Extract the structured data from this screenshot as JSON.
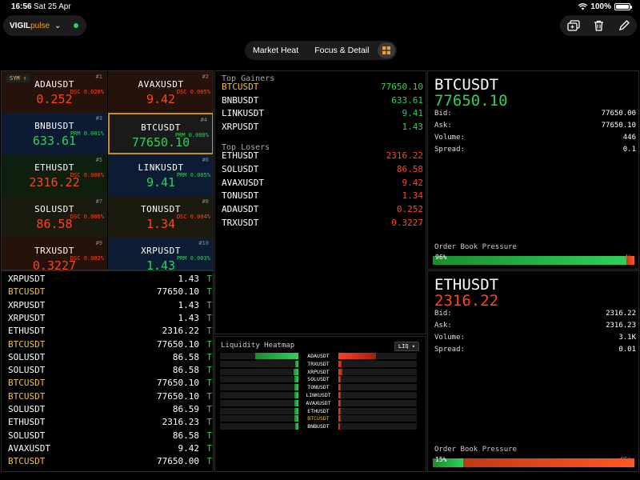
{
  "status_bar": {
    "time": "16:56",
    "date": "Sat 25 Apr",
    "battery": "100%"
  },
  "app": {
    "name_bold": "VIGIL",
    "name_light": "pulse",
    "connection_color": "#30d158"
  },
  "view_switcher": {
    "tabs": [
      "Market Heat",
      "Focus & Detail"
    ],
    "active_icon": "grid-icon"
  },
  "colors": {
    "up": "#30d158",
    "down": "#ff4520",
    "selected": "#f0c040"
  },
  "heat_grid": {
    "sort_label": "SYM ↑",
    "tiles": [
      {
        "symbol": "ADAUSDT",
        "price": "0.252",
        "rank": "#1",
        "tag": "DSC 0.020%",
        "dir": "dn"
      },
      {
        "symbol": "AVAXUSDT",
        "price": "9.42",
        "rank": "#2",
        "tag": "DSC 0.005%",
        "dir": "dn"
      },
      {
        "symbol": "BNBUSDT",
        "price": "633.61",
        "rank": "#3",
        "tag": "PRM 0.001%",
        "dir": "up"
      },
      {
        "symbol": "BTCUSDT",
        "price": "77650.10",
        "rank": "#4",
        "tag": "PRM 0.000%",
        "dir": "up"
      },
      {
        "symbol": "ETHUSDT",
        "price": "2316.22",
        "rank": "#5",
        "tag": "DSC 0.000%",
        "dir": "dn"
      },
      {
        "symbol": "LINKUSDT",
        "price": "9.41",
        "rank": "#6",
        "tag": "PRM 0.005%",
        "dir": "up"
      },
      {
        "symbol": "SOLUSDT",
        "price": "86.58",
        "rank": "#7",
        "tag": "DSC 0.006%",
        "dir": "dn"
      },
      {
        "symbol": "TONUSDT",
        "price": "1.34",
        "rank": "#8",
        "tag": "DSC 0.004%",
        "dir": "dn"
      },
      {
        "symbol": "TRXUSDT",
        "price": "0.3227",
        "rank": "#9",
        "tag": "DSC 0.002%",
        "dir": "dn"
      },
      {
        "symbol": "XRPUSDT",
        "price": "1.43",
        "rank": "#10",
        "tag": "PRM 0.003%",
        "dir": "up"
      }
    ]
  },
  "trade_feed": [
    {
      "symbol": "XRPUSDT",
      "price": "1.43",
      "flag": "T"
    },
    {
      "symbol": "BTCUSDT",
      "price": "77650.10",
      "flag": "T"
    },
    {
      "symbol": "XRPUSDT",
      "price": "1.43",
      "flag": "T"
    },
    {
      "symbol": "XRPUSDT",
      "price": "1.43",
      "flag": "T"
    },
    {
      "symbol": "ETHUSDT",
      "price": "2316.22",
      "flag": "T"
    },
    {
      "symbol": "BTCUSDT",
      "price": "77650.10",
      "flag": "T"
    },
    {
      "symbol": "SOLUSDT",
      "price": "86.58",
      "flag": "T"
    },
    {
      "symbol": "SOLUSDT",
      "price": "86.58",
      "flag": "T"
    },
    {
      "symbol": "BTCUSDT",
      "price": "77650.10",
      "flag": "T"
    },
    {
      "symbol": "BTCUSDT",
      "price": "77650.10",
      "flag": "T"
    },
    {
      "symbol": "SOLUSDT",
      "price": "86.59",
      "flag": "T"
    },
    {
      "symbol": "ETHUSDT",
      "price": "2316.23",
      "flag": "T"
    },
    {
      "symbol": "SOLUSDT",
      "price": "86.58",
      "flag": "T"
    },
    {
      "symbol": "AVAXUSDT",
      "price": "9.42",
      "flag": "T"
    },
    {
      "symbol": "BTCUSDT",
      "price": "77650.00",
      "flag": "T"
    }
  ],
  "movers": {
    "gainers_title": "Top Gainers",
    "gainers": [
      {
        "symbol": "BTCUSDT",
        "price": "77650.10"
      },
      {
        "symbol": "BNBUSDT",
        "price": "633.61"
      },
      {
        "symbol": "LINKUSDT",
        "price": "9.41"
      },
      {
        "symbol": "XRPUSDT",
        "price": "1.43"
      }
    ],
    "losers_title": "Top Losers",
    "losers": [
      {
        "symbol": "ETHUSDT",
        "price": "2316.22"
      },
      {
        "symbol": "SOLUSDT",
        "price": "86.58"
      },
      {
        "symbol": "AVAXUSDT",
        "price": "9.42"
      },
      {
        "symbol": "TONUSDT",
        "price": "1.34"
      },
      {
        "symbol": "ADAUSDT",
        "price": "0.252"
      },
      {
        "symbol": "TRXUSDT",
        "price": "0.3227"
      }
    ]
  },
  "liquidity_heatmap": {
    "title": "Liquidity Heatmap",
    "badge": "LIQ ▾",
    "rows": [
      {
        "symbol": "ADAUSDT",
        "bid_level": 0.55,
        "ask_level": 0.48
      },
      {
        "symbol": "TRXUSDT",
        "bid_level": 0.04,
        "ask_level": 0.04
      },
      {
        "symbol": "XRPUSDT",
        "bid_level": 0.06,
        "ask_level": 0.05
      },
      {
        "symbol": "SOLUSDT",
        "bid_level": 0.05,
        "ask_level": 0.03
      },
      {
        "symbol": "TONUSDT",
        "bid_level": 0.05,
        "ask_level": 0.03
      },
      {
        "symbol": "LINKUSDT",
        "bid_level": 0.05,
        "ask_level": 0.03
      },
      {
        "symbol": "AVAXUSDT",
        "bid_level": 0.05,
        "ask_level": 0.03
      },
      {
        "symbol": "ETHUSDT",
        "bid_level": 0.05,
        "ask_level": 0.03
      },
      {
        "symbol": "BTCUSDT",
        "bid_level": 0.05,
        "ask_level": 0.03
      },
      {
        "symbol": "BNBUSDT",
        "bid_level": 0.04,
        "ask_level": 0.02
      }
    ]
  },
  "detail_primary": {
    "symbol": "BTCUSDT",
    "price": "77650.10",
    "bid_label": "Bid:",
    "bid": "77650.00",
    "ask_label": "Ask:",
    "ask": "77650.10",
    "volume_label": "Volume:",
    "volume": "446",
    "spread_label": "Spread:",
    "spread": "0.1",
    "pressure_title": "Order Book Pressure",
    "bid_pct_label": "96%",
    "ask_pct_label": "4%",
    "bid_pct": 96
  },
  "detail_secondary": {
    "symbol": "ETHUSDT",
    "price": "2316.22",
    "bid_label": "Bid:",
    "bid": "2316.22",
    "ask_label": "Ask:",
    "ask": "2316.23",
    "volume_label": "Volume:",
    "volume": "3.1K",
    "spread_label": "Spread:",
    "spread": "0.01",
    "pressure_title": "Order Book Pressure",
    "bid_pct_label": "15%",
    "ask_pct_label": "85%",
    "bid_pct": 15
  }
}
